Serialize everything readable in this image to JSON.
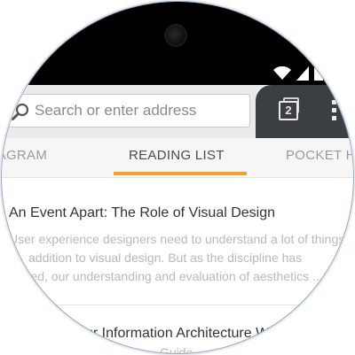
{
  "toolbar": {
    "search_placeholder": "Search or enter address",
    "tab_count": "2",
    "search_icon": "search-icon",
    "menu_icon": "overflow-menu-icon"
  },
  "status_bar": {
    "icons": [
      "wifi-icon",
      "signal-icon",
      "battery-icon"
    ]
  },
  "panel_tabs": [
    {
      "label": "STAGRAM",
      "selected": false
    },
    {
      "label": "READING LIST",
      "selected": true
    },
    {
      "label": "POCKET H",
      "selected": false
    }
  ],
  "reading_list": [
    {
      "title": "An Event Apart: The Role of Visual Design",
      "excerpt_lines": [
        "User experience designers need to understand a lot of things",
        "addition to visual design. But as the discipline has",
        "ured, our understanding and evaluation of aesthetics .."
      ]
    },
    {
      "title": "ur Information Architecture W",
      "excerpt": "Guide"
    }
  ],
  "colors": {
    "accent": "#f2a02f",
    "toolbar_bg": "#ebebeb",
    "tabs_bg": "#3b3f42",
    "status_bar": "#000000"
  }
}
